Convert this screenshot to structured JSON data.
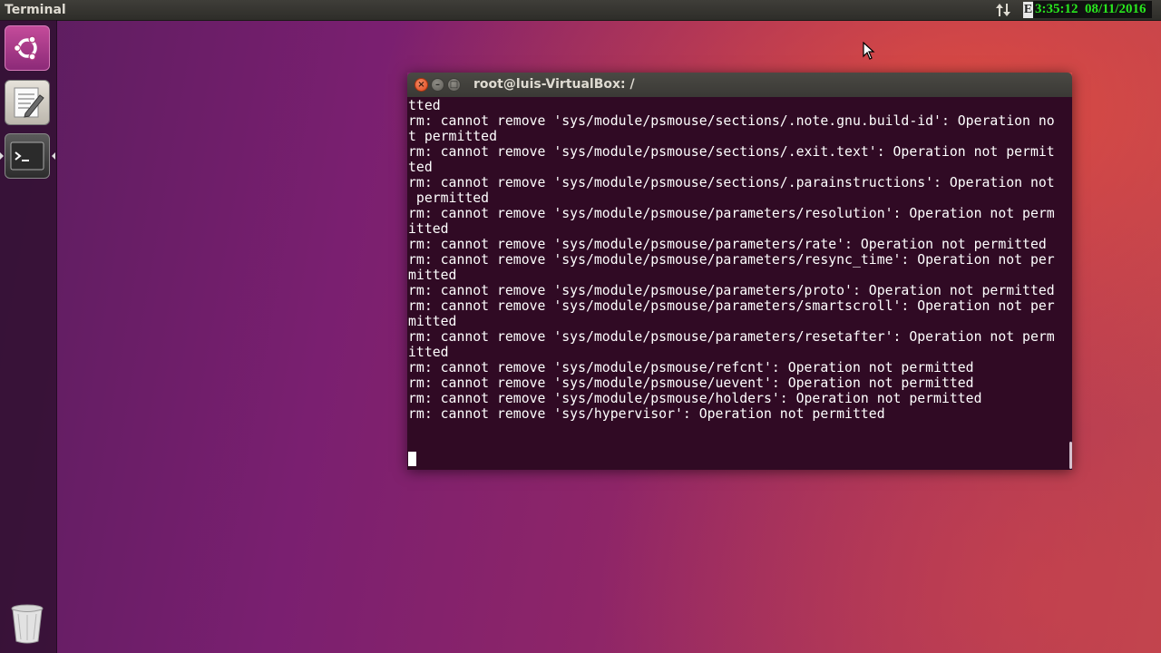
{
  "top_panel": {
    "app_title": "Terminal",
    "network_icon": "network-updown-icon",
    "clock_prefix": "E",
    "clock_text": "3:35:12  08/11/2016"
  },
  "launcher": {
    "items": [
      {
        "name": "dash",
        "icon": "ubuntu-logo-icon"
      },
      {
        "name": "text-editor",
        "icon": "text-editor-icon"
      },
      {
        "name": "terminal",
        "icon": "terminal-icon",
        "active": true
      },
      {
        "name": "trash",
        "icon": "trash-icon"
      }
    ]
  },
  "terminal_window": {
    "title": "root@luis-VirtualBox: /",
    "close_glyph": "×",
    "min_glyph": "–",
    "max_glyph": "□",
    "lines": [
      "tted",
      "rm: cannot remove 'sys/module/psmouse/sections/.note.gnu.build-id': Operation no",
      "t permitted",
      "rm: cannot remove 'sys/module/psmouse/sections/.exit.text': Operation not permit",
      "ted",
      "rm: cannot remove 'sys/module/psmouse/sections/.parainstructions': Operation not",
      " permitted",
      "rm: cannot remove 'sys/module/psmouse/parameters/resolution': Operation not perm",
      "itted",
      "rm: cannot remove 'sys/module/psmouse/parameters/rate': Operation not permitted",
      "rm: cannot remove 'sys/module/psmouse/parameters/resync_time': Operation not per",
      "mitted",
      "rm: cannot remove 'sys/module/psmouse/parameters/proto': Operation not permitted",
      "rm: cannot remove 'sys/module/psmouse/parameters/smartscroll': Operation not per",
      "mitted",
      "rm: cannot remove 'sys/module/psmouse/parameters/resetafter': Operation not perm",
      "itted",
      "rm: cannot remove 'sys/module/psmouse/refcnt': Operation not permitted",
      "rm: cannot remove 'sys/module/psmouse/uevent': Operation not permitted",
      "rm: cannot remove 'sys/module/psmouse/holders': Operation not permitted",
      "rm: cannot remove 'sys/hypervisor': Operation not permitted"
    ]
  },
  "colors": {
    "terminal_bg": "#300a24",
    "terminal_fg": "#ffffff",
    "clock_fg": "#29e81e",
    "close_button": "#e0491e"
  }
}
